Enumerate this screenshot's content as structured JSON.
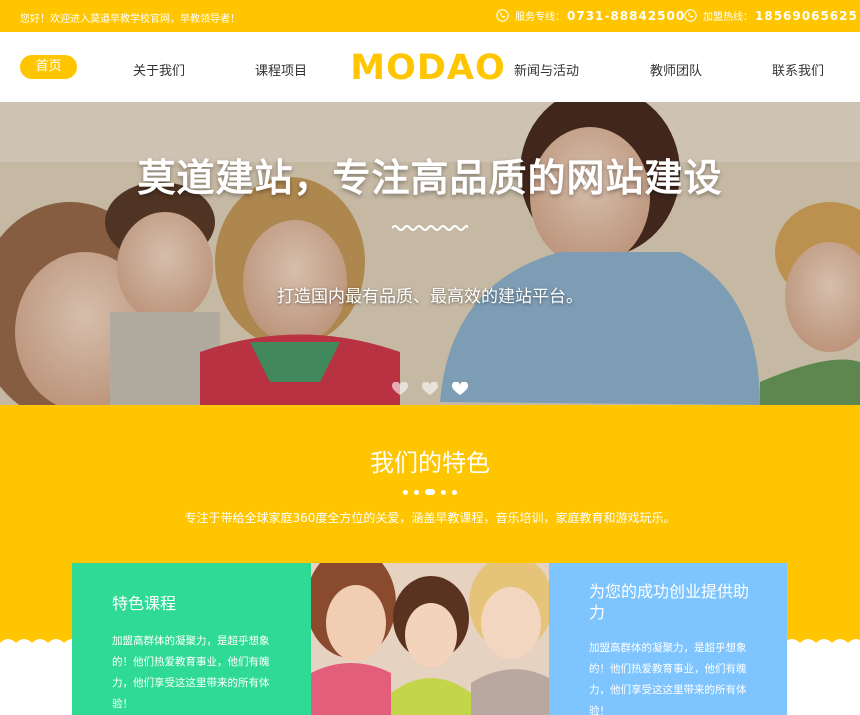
{
  "topbar": {
    "welcome": "您好！欢迎进入莫道早教学校官网，早教领导者！",
    "service_label": "服务专线：",
    "service_number": "0731-88842500",
    "join_label": "加盟热线：",
    "join_number": "18569065625"
  },
  "nav": {
    "items": [
      "首页",
      "关于我们",
      "课程项目",
      "新闻与活动",
      "教师团队",
      "联系我们"
    ],
    "active_index": 0
  },
  "logo": {
    "text": "MODAO"
  },
  "hero": {
    "title": "莫道建站，专注高品质的网站建设",
    "subtitle": "打造国内最有品质、最高效的建站平台。",
    "slides": 3,
    "active_slide": 2
  },
  "features": {
    "title": "我们的特色",
    "description": "专注于带给全球家庭360度全方位的关爱，涵盖早教课程，音乐培训，家庭教育和游戏玩乐。",
    "cards": [
      {
        "title": "特色课程",
        "text": "加盟高群体的凝聚力，是超乎想象的！他们热爱教育事业，他们有魄力，他们享受这这里带来的所有体验！"
      },
      {
        "title": "为您的成功创业提供助力",
        "text": "加盟高群体的凝聚力，是超乎想象的！他们热爱教育事业，他们有魄力，他们享受这这里带来的所有体验！"
      }
    ]
  },
  "colors": {
    "brand_yellow": "#ffc600",
    "green": "#2fdb94",
    "blue": "#7ec4ff"
  }
}
